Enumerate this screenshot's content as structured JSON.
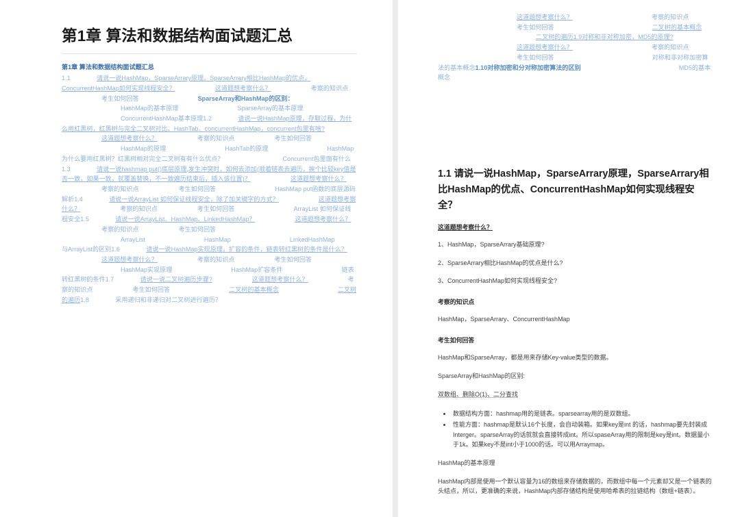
{
  "document": {
    "title": "第1章 算法和数据结构面试题汇总"
  },
  "left_page": {
    "toc_root_label": "第1章 算法和数据结构面试题汇总",
    "entries": [
      {
        "level": 1,
        "num": "1.1",
        "text": "请说一说HashMap，SparseArrary原理。SparseArrary相比HashMap的优点。ConcurrentHashMap如何实现线程安全？",
        "style": "underline"
      },
      {
        "level": 2,
        "text": "这道题想考察什么？",
        "style": "underline"
      },
      {
        "level": 2,
        "text": "考察的知识点",
        "style": "plain"
      },
      {
        "level": 2,
        "text": "考生如何回答",
        "style": "plain"
      },
      {
        "level": 3,
        "text": "SparseArray和HashMap的区别：",
        "style": "bold"
      },
      {
        "level": 3,
        "text": "HashMap的基本原理",
        "style": "plain"
      },
      {
        "level": 3,
        "text": "SparseArray的基本原理",
        "style": "plain"
      },
      {
        "level": 3,
        "text": "ConcurrentHashMap基本原理",
        "style": "plain"
      },
      {
        "level": 1,
        "num": "1.2",
        "text": "请说一说HashMap原理，存取过程，为什么用红黑树，红黑树与完全二叉树对比。HashTab、concurrentHashMap，concurrent包里有啥?",
        "style": "underline"
      },
      {
        "level": 2,
        "text": "这道题想考察什么？",
        "style": "underline"
      },
      {
        "level": 2,
        "text": "考察的知识点",
        "style": "plain"
      },
      {
        "level": 2,
        "text": "考生如何回答",
        "style": "plain"
      },
      {
        "level": 3,
        "text": "HashMap的原理",
        "style": "plain"
      },
      {
        "level": 3,
        "text": "HashTab的原理",
        "style": "plain"
      },
      {
        "level": 3,
        "text": "HashMap为什么要用红黑树？红黑树相对完全二叉树有有什么优点？",
        "style": "plain"
      },
      {
        "level": 3,
        "text": "Concurrent包里面有什么",
        "style": "plain"
      },
      {
        "level": 1,
        "num": "1.3",
        "text": "请说一说hashmap put()底层原理,发生冲突时，如何去添加(顺着链表去遍历，挨个比较key值是否一致，如果一致，就覆盖替换，不一致遍历结束后，插入该位置)？",
        "style": "underline"
      },
      {
        "level": 2,
        "text": "这道题想考察什么？",
        "style": "underline"
      },
      {
        "level": 2,
        "text": "考察的知识点",
        "style": "plain"
      },
      {
        "level": 2,
        "text": "考生如何回答",
        "style": "plain"
      },
      {
        "level": 3,
        "text": "HashMap put函数的底层源码解析",
        "style": "plain"
      },
      {
        "level": 1,
        "num": "1.4",
        "text": "请说一说ArrayList 如何保证线程安全，除了加关键字的方式？",
        "style": "underline"
      },
      {
        "level": 2,
        "text": "这道题想考察什么？",
        "style": "underline"
      },
      {
        "level": 2,
        "text": "考察的知识点",
        "style": "plain"
      },
      {
        "level": 2,
        "text": "考生如何回答",
        "style": "plain"
      },
      {
        "level": 3,
        "text": "ArrayList 如何保证线程安全",
        "style": "plain"
      },
      {
        "level": 1,
        "num": "1.5",
        "text": "请说一说ArrayList、HashMap、LinkedHashMap？",
        "style": "underline"
      },
      {
        "level": 2,
        "text": "这道题想考察什么？",
        "style": "underline"
      },
      {
        "level": 2,
        "text": "考察的知识点",
        "style": "plain"
      },
      {
        "level": 2,
        "text": "考生如何回答",
        "style": "plain"
      },
      {
        "level": 3,
        "text": "ArrayList",
        "style": "plain"
      },
      {
        "level": 3,
        "text": "HashMap",
        "style": "plain"
      },
      {
        "level": 3,
        "text": "LinkedHashMap",
        "style": "plain"
      },
      {
        "level": 3,
        "text": "LinkedList与ArrayList的区别",
        "style": "plain"
      },
      {
        "level": 1,
        "num": "1.6",
        "text": "请说一说HashMap实现原理，扩容的条件，链表转红黑树的条件是什么？",
        "style": "underline"
      },
      {
        "level": 2,
        "text": "这道题想考察什么？",
        "style": "underline"
      },
      {
        "level": 2,
        "text": "考察的知识点",
        "style": "plain"
      },
      {
        "level": 2,
        "text": "考生如何回答",
        "style": "plain"
      },
      {
        "level": 3,
        "text": "HashMap实现原理",
        "style": "plain"
      },
      {
        "level": 3,
        "text": "HashMap扩容条件",
        "style": "plain"
      },
      {
        "level": 3,
        "text": "链表转红黑树的条件",
        "style": "plain"
      },
      {
        "level": 1,
        "num": "1.7",
        "text": "请说一说二叉树遍历步骤?",
        "style": "underline"
      },
      {
        "level": 2,
        "text": "这道题想考察什么？",
        "style": "underline"
      },
      {
        "level": 2,
        "text": "考察的知识点",
        "style": "plain"
      },
      {
        "level": 2,
        "text": "考生如何回答",
        "style": "plain"
      },
      {
        "level": 3,
        "text": "二叉树的基本概念",
        "style": "underline"
      },
      {
        "level": 3,
        "text": "二叉树的遍历",
        "style": "underline"
      },
      {
        "level": 1,
        "num": "1.8",
        "text": "采用递归和非递归对二叉树进行遍历？",
        "style": "nonum"
      }
    ]
  },
  "right_page": {
    "toc_continued": [
      {
        "level": 2,
        "text": "这道题想考察什么？",
        "style": "underline"
      },
      {
        "level": 2,
        "text": "考察的知识点",
        "style": "plain"
      },
      {
        "level": 2,
        "text": "考生如何回答",
        "style": "plain"
      },
      {
        "level": 3,
        "text": "二叉树的基本概念",
        "style": "underline"
      },
      {
        "level": 3,
        "text": "二叉树的遍历",
        "style": "underline"
      },
      {
        "level": 1,
        "text": "1.9对称和非对称加密，MD5的原理?",
        "style": "underline"
      },
      {
        "level": 2,
        "text": "这道题想考察什么？",
        "style": "underline"
      },
      {
        "level": 2,
        "text": "考察的知识点",
        "style": "plain"
      },
      {
        "level": 2,
        "text": "考生如何回答",
        "style": "plain"
      },
      {
        "level": 3,
        "text": "对称和非对称加密算法的基本概念",
        "style": "plain"
      },
      {
        "level": 1,
        "text": "1.10对称加密和分对称加密算法的区别",
        "style": "bold"
      },
      {
        "level": 3,
        "text": "MD5的基本概念",
        "style": "plain"
      }
    ],
    "section": {
      "title": "1.1 请说一说HashMap，SparseArrary原理，SparseArrary相比HashMap的优点、ConcurrentHashMap如何实现线程安全？",
      "lead_label": "这道题想考察什么？",
      "questions": [
        "1、HashMap，SparseArrary基础原理?",
        "2、SparseArrary相比HashMap的优点是什么?",
        "3、ConcurrentHashMap如何实现线程安全?"
      ],
      "knowledge_label": "考察的知识点",
      "knowledge_text": "HashMap，SparseArrary、ConcurrentHashMap",
      "answer_label": "考生如何回答",
      "answer_intro": "HashMap和SparseArray，都是用来存储Key-value类型的数据。",
      "diff_label": "SparseArray和HashMap的区别:",
      "diff_summary": "双数组、删除O(1)、二分查找",
      "bullets": [
        "数据结构方面：hashmap用的是链表。sparsearray用的是双数组。",
        "性能方面：hashmap是默认16个长度，会自动装箱。如果key是int 的话，hashmap要先封装成Interger。sparseArray的话就就会直接转成int。所以spaseArray用的限制是key是int。数据量小于1k。如果key不是int小于1000的话。可以用Arraymap。"
      ],
      "principle_label": "HashMap的基本原理",
      "principle_text": "HashMap内部是使用一个默认容量为16的数组来存储数据的，而数组中每一个元素却又是一个链表的头结点，所以，更准确的来说，HashMap内部存储结构是使用哈希表的拉链结构（数组+链表）。"
    }
  },
  "colors": {
    "toc_link": "#8fb3de",
    "toc_root": "#3e6fa8",
    "toc_bold": "#5d8ec4",
    "title": "#1a1a1a",
    "body": "#3f3f3f",
    "gutter": "#ececec",
    "rule": "#e3e3e3"
  }
}
